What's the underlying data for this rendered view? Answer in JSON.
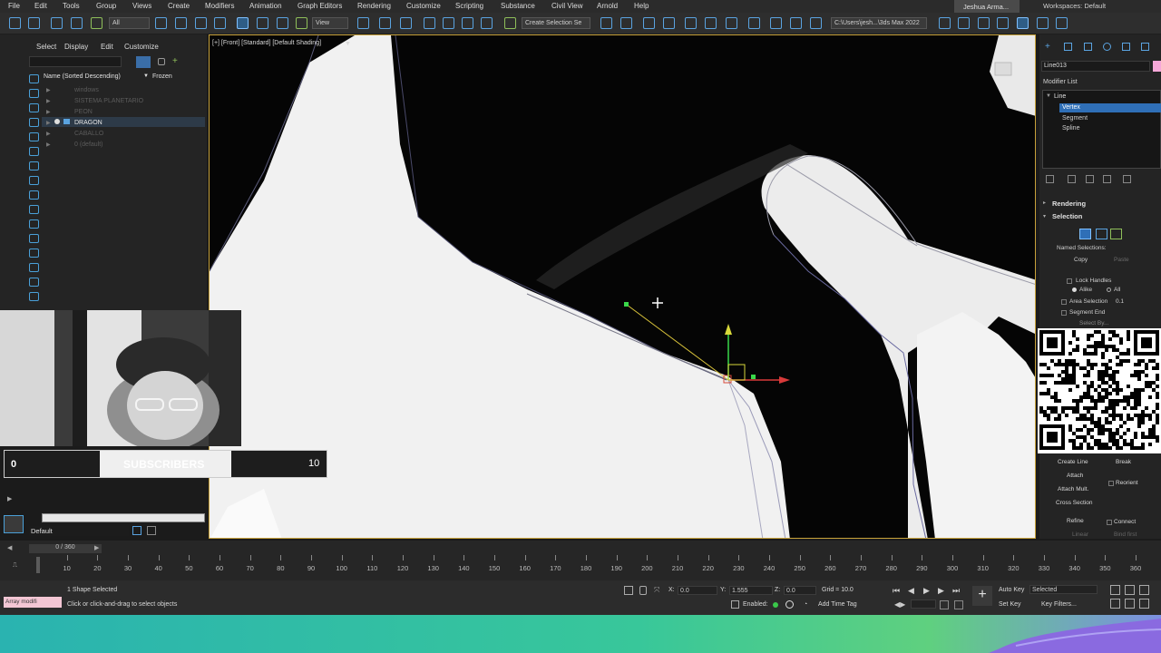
{
  "menu": [
    "File",
    "Edit",
    "Tools",
    "Group",
    "Views",
    "Create",
    "Modifiers",
    "Animation",
    "Graph Editors",
    "Rendering",
    "Customize",
    "Scripting",
    "Substance",
    "Civil View",
    "Arnold",
    "Help"
  ],
  "user": "Jeshua Arma...",
  "workspace": {
    "label": "Workspaces:",
    "value": "Default"
  },
  "toolbar": {
    "filter_all": "All",
    "view_dropdown": "View",
    "selection_set": "Create Selection Se",
    "project_path": "C:\\Users\\jesh...\\3ds Max 2022"
  },
  "explorer": {
    "tabs": [
      "Select",
      "Display",
      "Edit",
      "Customize"
    ],
    "header_name": "Name (Sorted Descending)",
    "header_frozen": "Frozen",
    "rows": [
      {
        "label": "windows",
        "state": "dim"
      },
      {
        "label": "SISTEMA PLANETARIO",
        "state": "dim"
      },
      {
        "label": "PEON",
        "state": "dim"
      },
      {
        "label": "DRAGON",
        "state": "sel"
      },
      {
        "label": "CABALLO",
        "state": "dim"
      },
      {
        "label": "0 (default)",
        "state": "dim"
      }
    ]
  },
  "viewport": {
    "label": "[+] [Front] [Standard] [Default Shading]"
  },
  "subscribers": {
    "min": "0",
    "label": "SUBSCRIBERS",
    "max": "10"
  },
  "layer": {
    "current": "Default"
  },
  "timeline": {
    "slider": "0 / 360",
    "ticks": [
      "10",
      "20",
      "30",
      "40",
      "50",
      "60",
      "70",
      "80",
      "90",
      "100",
      "110",
      "120",
      "130",
      "140",
      "150",
      "160",
      "170",
      "180",
      "190",
      "200",
      "210",
      "220",
      "230",
      "240",
      "250",
      "260",
      "270",
      "280",
      "290",
      "300",
      "310",
      "320",
      "330",
      "340",
      "350",
      "360"
    ]
  },
  "status": {
    "maxscript": "Array modifi",
    "selection": "1 Shape Selected",
    "prompt": "Click or click-and-drag to select objects",
    "x_label": "X:",
    "x_value": "0.0",
    "y_label": "Y:",
    "y_value": "1.555",
    "z_label": "Z:",
    "z_value": "0.0",
    "grid": "Grid = 10.0",
    "enabled": "Enabled:",
    "add_time_tag": "Add Time Tag",
    "auto_key": "Auto Key",
    "set_key": "Set Key",
    "selected": "Selected",
    "key_filters": "Key Filters..."
  },
  "command_panel": {
    "object_name": "Line013",
    "modifier_list": "Modifier List",
    "stack": [
      "Line",
      "Vertex",
      "Segment",
      "Spline"
    ],
    "rollouts": [
      "Rendering",
      "Selection"
    ],
    "named_selections": "Named Selections:",
    "copy": "Copy",
    "paste": "Paste",
    "lock_handles": "Lock Handles",
    "alike": "Alike",
    "all": "All",
    "area_selection": "Area Selection",
    "area_value": "0.1",
    "segment_end": "Segment End",
    "select_by": "Select By...",
    "create_line": "Create Line",
    "break": "Break",
    "attach": "Attach",
    "reorient": "Reorient",
    "attach_mult": "Attach Mult.",
    "cross_section": "Cross Section",
    "refine": "Refine",
    "connect": "Connect",
    "linear": "Linear",
    "bind_first": "Bind first"
  },
  "colors": {
    "accent": "#2f6fb7",
    "viewport_border": "#c8a23a",
    "strip": "#2ab3b0"
  }
}
